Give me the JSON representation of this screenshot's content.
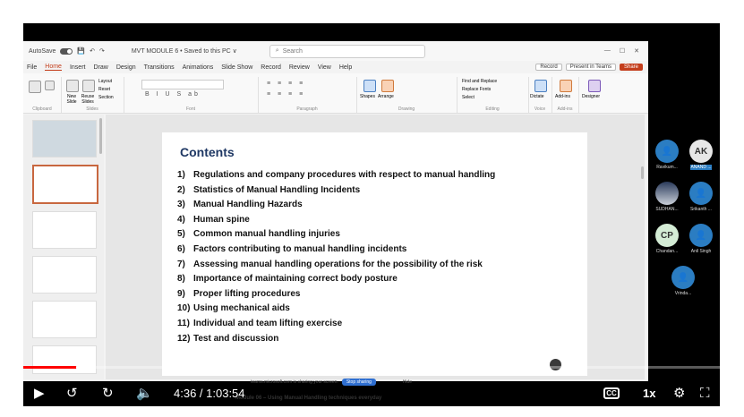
{
  "window": {
    "autosave_label": "AutoSave",
    "doc_title": "MVT MODULE 6 • Saved to this PC ∨",
    "search_placeholder": "Search"
  },
  "menu": {
    "items": [
      "File",
      "Home",
      "Insert",
      "Draw",
      "Design",
      "Transitions",
      "Animations",
      "Slide Show",
      "Record",
      "Review",
      "View",
      "Help"
    ],
    "active": "Home",
    "record_btn": "Record",
    "present_btn": "Present in Teams",
    "share_btn": "Share"
  },
  "ribbon": {
    "groups": [
      "Clipboard",
      "Slides",
      "Font",
      "Paragraph",
      "Drawing",
      "Editing",
      "Voice",
      "Add-ins"
    ],
    "buttons": {
      "new_slide": "New Slide",
      "reuse_slides": "Reuse Slides",
      "layout": "Layout",
      "reset": "Reset",
      "section": "Section",
      "shapes": "Shapes",
      "arrange": "Arrange",
      "find_replace": "Find and Replace",
      "replace_fonts": "Replace Fonts",
      "select": "Select",
      "dictate": "Dictate",
      "add_ins": "Add-ins",
      "designer": "Designer"
    }
  },
  "slide": {
    "title": "Contents",
    "items": [
      {
        "num": "1)",
        "text": "Regulations and company procedures with respect to manual handling"
      },
      {
        "num": "2)",
        "text": "Statistics of Manual Handling Incidents"
      },
      {
        "num": "3)",
        "text": "Manual Handling Hazards"
      },
      {
        "num": "4)",
        "text": "Human spine"
      },
      {
        "num": "5)",
        "text": "Common manual handling injuries"
      },
      {
        "num": "6)",
        "text": "Factors contributing to manual handling incidents"
      },
      {
        "num": "7)",
        "text": "Assessing manual handling operations for the possibility of the risk"
      },
      {
        "num": "8)",
        "text": "Importance of maintaining correct body posture"
      },
      {
        "num": "9)",
        "text": "Proper lifting procedures"
      },
      {
        "num": "10)",
        "text": "Using mechanical aids"
      },
      {
        "num": "11)",
        "text": "Individual and team lifting exercise"
      },
      {
        "num": "12)",
        "text": "Test and discussion"
      }
    ],
    "footer": "Module 06 – Using Manual Handling techniques everyday"
  },
  "sharing": {
    "notice": "teams.microsoft.com is sharing your screen.",
    "stop_btn": "Stop sharing",
    "hide_btn": "Hide"
  },
  "status": {
    "slide": "English",
    "accessibility": "Accessibility: Investigate"
  },
  "participants": [
    {
      "initials": "",
      "name": "Ravikum...",
      "style": "blue"
    },
    {
      "initials": "AK",
      "name": "ANAND ...",
      "style": "light",
      "highlight": true
    },
    {
      "initials": "",
      "name": "SUDHAN...",
      "style": "photo"
    },
    {
      "initials": "",
      "name": "Srikanth ...",
      "style": "blue"
    },
    {
      "initials": "CP",
      "name": "Chandan...",
      "style": "green"
    },
    {
      "initials": "",
      "name": "Anil Singh",
      "style": "blue"
    },
    {
      "initials": "",
      "name": "Vrinda...",
      "style": "blue"
    }
  ],
  "player": {
    "time": "4:36 / 1:03:54",
    "speed": "1x",
    "cc_label": "CC",
    "progress_fraction": 0.073
  },
  "colors": {
    "accent": "#c43e1c",
    "title": "#1f3864",
    "teams_blue": "#2b7dc2",
    "progress": "#ff0000"
  }
}
